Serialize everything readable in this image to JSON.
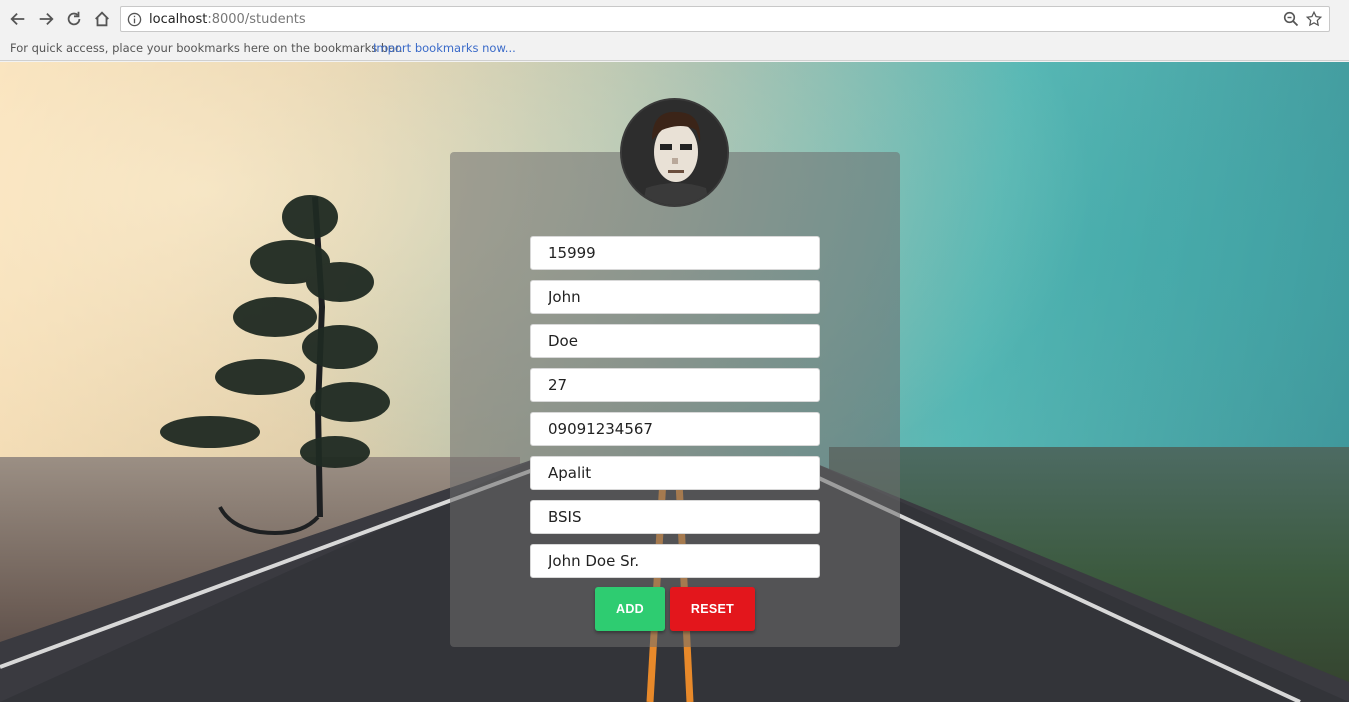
{
  "browser": {
    "url_host": "localhost",
    "url_path": ":8000/students",
    "bookmarks_message": "For quick access, place your bookmarks here on the bookmarks bar.",
    "bookmarks_link": "Import bookmarks now..."
  },
  "form": {
    "fields": [
      {
        "name": "student-id-field",
        "value": "15999"
      },
      {
        "name": "first-name-field",
        "value": "John"
      },
      {
        "name": "last-name-field",
        "value": "Doe"
      },
      {
        "name": "age-field",
        "value": "27"
      },
      {
        "name": "contact-number-field",
        "value": "09091234567"
      },
      {
        "name": "address-field",
        "value": "Apalit"
      },
      {
        "name": "course-field",
        "value": "BSIS"
      },
      {
        "name": "guardian-field",
        "value": "John Doe Sr."
      }
    ],
    "add_label": "ADD",
    "reset_label": "RESET"
  },
  "colors": {
    "add_button": "#2ecc71",
    "reset_button": "#e3161c"
  }
}
